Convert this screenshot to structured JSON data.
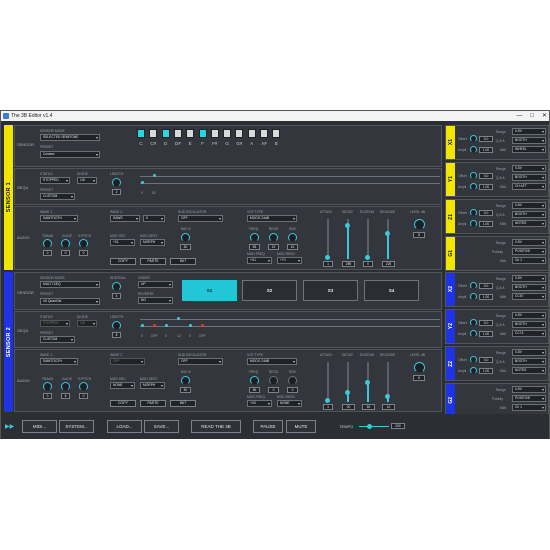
{
  "title": "The 3B Editor v1.4",
  "accent": "#3ec7d9",
  "sensor1_color": "#f2e600",
  "sensor2_color": "#1e33e6",
  "sensors": [
    {
      "name": "SENSOR 1",
      "sections": {
        "sensor": "SENSOR",
        "sequ": "SEQU",
        "audio": "AUDIO"
      },
      "sensor_mode_label": "SENSOR MODE",
      "sensor_mode": "SELECTED SEMITONE",
      "preset_label": "PRESET",
      "preset": "Custom",
      "keys": [
        "C",
        "C#",
        "D",
        "D#",
        "E",
        "F",
        "F#",
        "G",
        "G#",
        "A",
        "A#",
        "B"
      ],
      "status_label": "STATUS",
      "status": "STOPPED",
      "divide_label": "DIVIDE",
      "divide": "1/8",
      "seq_preset_label": "PRESET",
      "seq_preset": "CUSTOM",
      "length_label": "LENGTH",
      "length": "2",
      "track_labels": [
        "0",
        "52"
      ],
      "wave1_label": "WAVE 1",
      "wave1": "SAWTOOTH",
      "wave2_label": "WAVE 2",
      "wave2": "SAWS",
      "wave2b": "0",
      "trans_label": "TRANS",
      "glide_label": "GLIDE",
      "hpitch_label": "H PITCH",
      "trans": "0",
      "glide": "0",
      "hpitch": "0",
      "mod_src_label": "MOD SRC",
      "mod_src": "+01",
      "mod_dest_label": "MOD DEST",
      "mod_dest": "MORPH",
      "sub_osc_label": "SUB OSCILLATOR",
      "sub_osc": "OFF",
      "mix_label": "MIX %",
      "mix": "50",
      "vcf_type_label": "VCF TYPE",
      "vcf_type": "MOOG 24dB",
      "freq_label": "FREQ",
      "reso_label": "RESO",
      "env_label": "ENV",
      "freq": "55",
      "reso": "19",
      "env": "42",
      "mod_freq_label": "MOD FREQ",
      "mod_reso_label": "MOD RESO",
      "mod_freq": "+X1",
      "mod_reso": "+Y1",
      "attack_label": "ATTACK",
      "decay_label": "DECAY",
      "sustain_label": "SUSTAIN",
      "release_label": "RELEASE",
      "level_label": "LEVEL dB",
      "attack": "1",
      "decay": "289",
      "sustain": "0",
      "release": "225",
      "level": "8",
      "copy": "COPY",
      "paste": "PASTE",
      "init": "INIT"
    },
    {
      "name": "SENSOR 2",
      "sections": {
        "sensor": "SENSOR",
        "sequ": "SEQU",
        "audio": "AUDIO"
      },
      "sensor_mode_label": "SENSOR MODE",
      "sensor_mode": "MULTI SEQ",
      "preset_label": "PRESET",
      "preset": "4X QuanGet",
      "interval_label": "INTERVAL",
      "interval": "4",
      "order_label": "ORDER",
      "order": "UP",
      "reverse_label": "REVERSE",
      "reverse": "NO",
      "steps": [
        "S1",
        "S2",
        "S3",
        "S4"
      ],
      "status_label": "STATUS",
      "status": "STOPPED",
      "divide_label": "DIVIDE",
      "divide": "1/8",
      "seq_preset_label": "PRESET",
      "seq_preset": "CUSTOM",
      "length_label": "LENGTH",
      "length": "8",
      "track_labels": [
        "0",
        "OFF",
        "0",
        "12",
        "0",
        "OFF"
      ],
      "wave1_label": "WAVE 1",
      "wave1": "SAWTOOTH",
      "wave2_label": "WAVE 2",
      "wave2": "OFF",
      "trans_label": "TRANS",
      "glide_label": "GLIDE",
      "hpitch_label": "H PITCH",
      "trans": "0",
      "glide": "8",
      "hpitch": "0",
      "mod_src_label": "MOD SRC",
      "mod_src": "NONE",
      "mod_dest_label": "MOD DEST",
      "mod_dest": "MORPH",
      "sub_osc_label": "SUB OSCILLATOR",
      "sub_osc": "OFF",
      "mix_label": "MIX %",
      "mix": "50",
      "vcf_type_label": "VCF TYPE",
      "vcf_type": "MOOG 24dB",
      "freq_label": "FREQ",
      "reso_label": "RESO",
      "env_label": "ENV",
      "freq": "56",
      "reso": "0",
      "env": "0",
      "mod_freq_label": "MOD FREQ",
      "mod_reso_label": "MOD RESO",
      "mod_freq": "+X2",
      "mod_reso": "NONE",
      "attack_label": "ATTACK",
      "decay_label": "DECAY",
      "sustain_label": "SUSTAIN",
      "release_label": "RELEASE",
      "level_label": "LEVEL dB",
      "attack": "1",
      "decay": "20",
      "sustain": "50",
      "release": "10",
      "level": "6",
      "copy": "COPY",
      "paste": "PASTE",
      "init": "INIT"
    }
  ],
  "outputs": [
    {
      "id": "X1",
      "range_label": "Range",
      "range": "0-5V",
      "offset_label": "Offset",
      "offset": "0.0",
      "qa_label": "Q & A",
      "qa": "BOOTH",
      "ampl_label": "Ampli.",
      "ampl": "1.00",
      "midi_label": "Midi",
      "midi": "WHEEL"
    },
    {
      "id": "Y1",
      "range_label": "Range",
      "range": "0-5V",
      "offset_label": "Offset",
      "offset": "0.0",
      "qa_label": "Q & A",
      "qa": "BOOTH",
      "ampl_label": "Ampli.",
      "ampl": "1.00",
      "midi_label": "Midi",
      "midi": "CH AFT"
    },
    {
      "id": "Z1",
      "range_label": "Range",
      "range": "0-8V",
      "offset_label": "Offset",
      "offset": "0.0",
      "qa_label": "Q & A",
      "qa": "BOOTH",
      "ampl_label": "Ampli.",
      "ampl": "1.00",
      "midi_label": "Midi",
      "midi": "NOTES"
    },
    {
      "id": "G1",
      "gate": true,
      "range_label": "Range",
      "range": "0-5V",
      "polarity_label": "Polarity",
      "polarity": "POSITIVE",
      "midi_label": "Midi",
      "midi": "Ch 1"
    },
    {
      "id": "X2",
      "range_label": "Range",
      "range": "0-5V",
      "offset_label": "Offset",
      "offset": "0.0",
      "qa_label": "Q & A",
      "qa": "BOOTH",
      "ampl_label": "Ampli.",
      "ampl": "1.00",
      "midi_label": "Midi",
      "midi": "CC57"
    },
    {
      "id": "Y2",
      "range_label": "Range",
      "range": "0-5V",
      "offset_label": "Offset",
      "offset": "0.0",
      "qa_label": "Q & A",
      "qa": "BOOTH",
      "ampl_label": "Ampli.",
      "ampl": "1.00",
      "midi_label": "Midi",
      "midi": "CC74"
    },
    {
      "id": "Z2",
      "range_label": "Range",
      "range": "0-8V",
      "offset_label": "Offset",
      "offset": "0.0",
      "qa_label": "Q & A",
      "qa": "BOOTH",
      "ampl_label": "Ampli.",
      "ampl": "1.00",
      "midi_label": "Midi",
      "midi": "NOTES"
    },
    {
      "id": "G2",
      "gate": true,
      "range_label": "Range",
      "range": "0-5V",
      "polarity_label": "Polarity",
      "polarity": "POSITIVE",
      "midi_label": "Midi",
      "midi": "Ch 1"
    }
  ],
  "footer": {
    "midi": "MIDI...",
    "system": "SYSTEM...",
    "load": "LOAD...",
    "save": "SAVE...",
    "read": "READ THE 3B",
    "pause": "PAUSE",
    "mute": "MUTE",
    "tempo_label": "TEMPO",
    "tempo": "200"
  }
}
